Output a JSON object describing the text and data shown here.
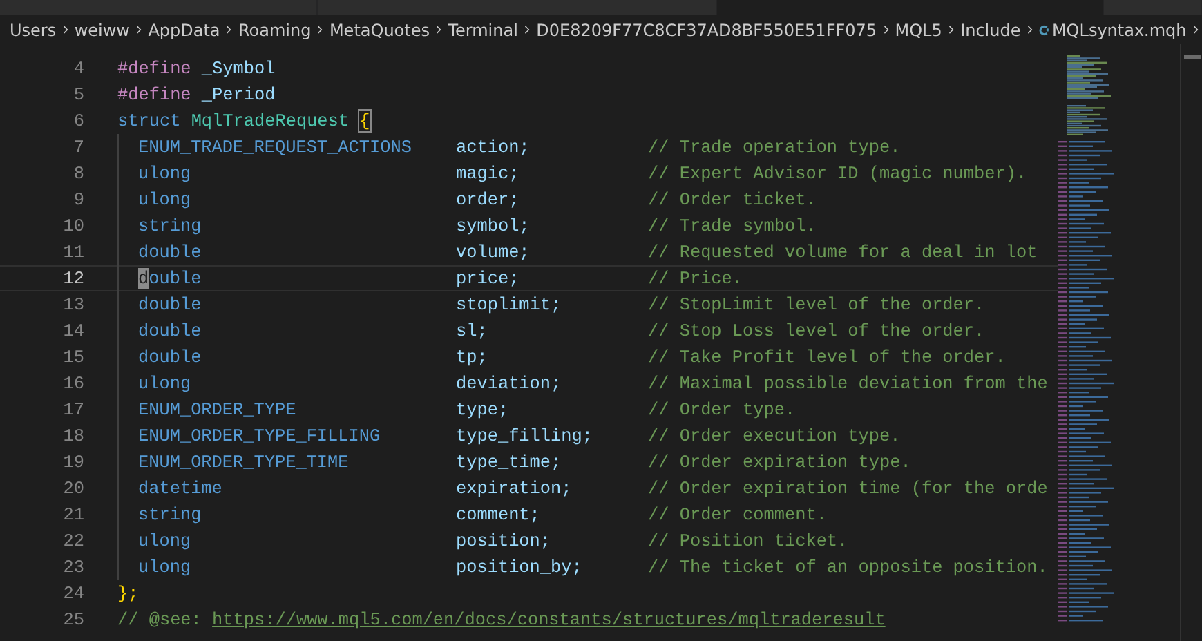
{
  "tabs": [
    {
      "selected": false
    },
    {
      "selected": false
    },
    {
      "selected": true
    },
    {
      "selected": false
    }
  ],
  "breadcrumb": {
    "items": [
      {
        "label": "Users",
        "kind": "folder"
      },
      {
        "label": "weiww",
        "kind": "folder"
      },
      {
        "label": "AppData",
        "kind": "folder"
      },
      {
        "label": "Roaming",
        "kind": "folder"
      },
      {
        "label": "MetaQuotes",
        "kind": "folder"
      },
      {
        "label": "Terminal",
        "kind": "folder"
      },
      {
        "label": "D0E8209F77C8CF37AD8BF550E51FF075",
        "kind": "folder"
      },
      {
        "label": "MQL5",
        "kind": "folder"
      },
      {
        "label": "Include",
        "kind": "folder"
      },
      {
        "label": "MQLsyntax.mqh",
        "kind": "file"
      }
    ]
  },
  "editor": {
    "lines": [
      {
        "number": "4",
        "kind": "define",
        "keyword": "#define",
        "name": "_Symbol",
        "current": false
      },
      {
        "number": "5",
        "kind": "define",
        "keyword": "#define",
        "name": "_Period",
        "current": false
      },
      {
        "number": "6",
        "kind": "struct",
        "keyword": "struct",
        "name": "MqlTradeRequest",
        "brace": "{",
        "current": false
      },
      {
        "number": "7",
        "kind": "field",
        "type": "ENUM_TRADE_REQUEST_ACTIONS",
        "name": "action;",
        "comment": "// Trade operation type.",
        "current": false
      },
      {
        "number": "8",
        "kind": "field",
        "type": "ulong",
        "name": "magic;",
        "comment": "// Expert Advisor ID (magic number).",
        "current": false
      },
      {
        "number": "9",
        "kind": "field",
        "type": "ulong",
        "name": "order;",
        "comment": "// Order ticket.",
        "current": false
      },
      {
        "number": "10",
        "kind": "field",
        "type": "string",
        "name": "symbol;",
        "comment": "// Trade symbol.",
        "current": false
      },
      {
        "number": "11",
        "kind": "field",
        "type": "double",
        "name": "volume;",
        "comment": "// Requested volume for a deal in lot",
        "current": false
      },
      {
        "number": "12",
        "kind": "field",
        "type": "double",
        "name": "price;",
        "comment": "// Price.",
        "current": true
      },
      {
        "number": "13",
        "kind": "field",
        "type": "double",
        "name": "stoplimit;",
        "comment": "// StopLimit level of the order.",
        "current": false
      },
      {
        "number": "14",
        "kind": "field",
        "type": "double",
        "name": "sl;",
        "comment": "// Stop Loss level of the order.",
        "current": false
      },
      {
        "number": "15",
        "kind": "field",
        "type": "double",
        "name": "tp;",
        "comment": "// Take Profit level of the order.",
        "current": false
      },
      {
        "number": "16",
        "kind": "field",
        "type": "ulong",
        "name": "deviation;",
        "comment": "// Maximal possible deviation from the",
        "current": false
      },
      {
        "number": "17",
        "kind": "field",
        "type": "ENUM_ORDER_TYPE",
        "name": "type;",
        "comment": "// Order type.",
        "current": false
      },
      {
        "number": "18",
        "kind": "field",
        "type": "ENUM_ORDER_TYPE_FILLING",
        "name": "type_filling;",
        "comment": "// Order execution type.",
        "current": false
      },
      {
        "number": "19",
        "kind": "field",
        "type": "ENUM_ORDER_TYPE_TIME",
        "name": "type_time;",
        "comment": "// Order expiration type.",
        "current": false
      },
      {
        "number": "20",
        "kind": "field",
        "type": "datetime",
        "name": "expiration;",
        "comment": "// Order expiration time (for the orde",
        "current": false
      },
      {
        "number": "21",
        "kind": "field",
        "type": "string",
        "name": "comment;",
        "comment": "// Order comment.",
        "current": false
      },
      {
        "number": "22",
        "kind": "field",
        "type": "ulong",
        "name": "position;",
        "comment": "// Position ticket.",
        "current": false
      },
      {
        "number": "23",
        "kind": "field",
        "type": "ulong",
        "name": "position_by;",
        "comment": "// The ticket of an opposite position.",
        "current": false
      },
      {
        "number": "24",
        "kind": "close",
        "text": "};",
        "current": false
      },
      {
        "number": "25",
        "kind": "see",
        "prefix": "// @see:",
        "link": "https://www.mql5.com/en/docs/constants/structures/mqltraderesult",
        "current": false
      }
    ]
  }
}
